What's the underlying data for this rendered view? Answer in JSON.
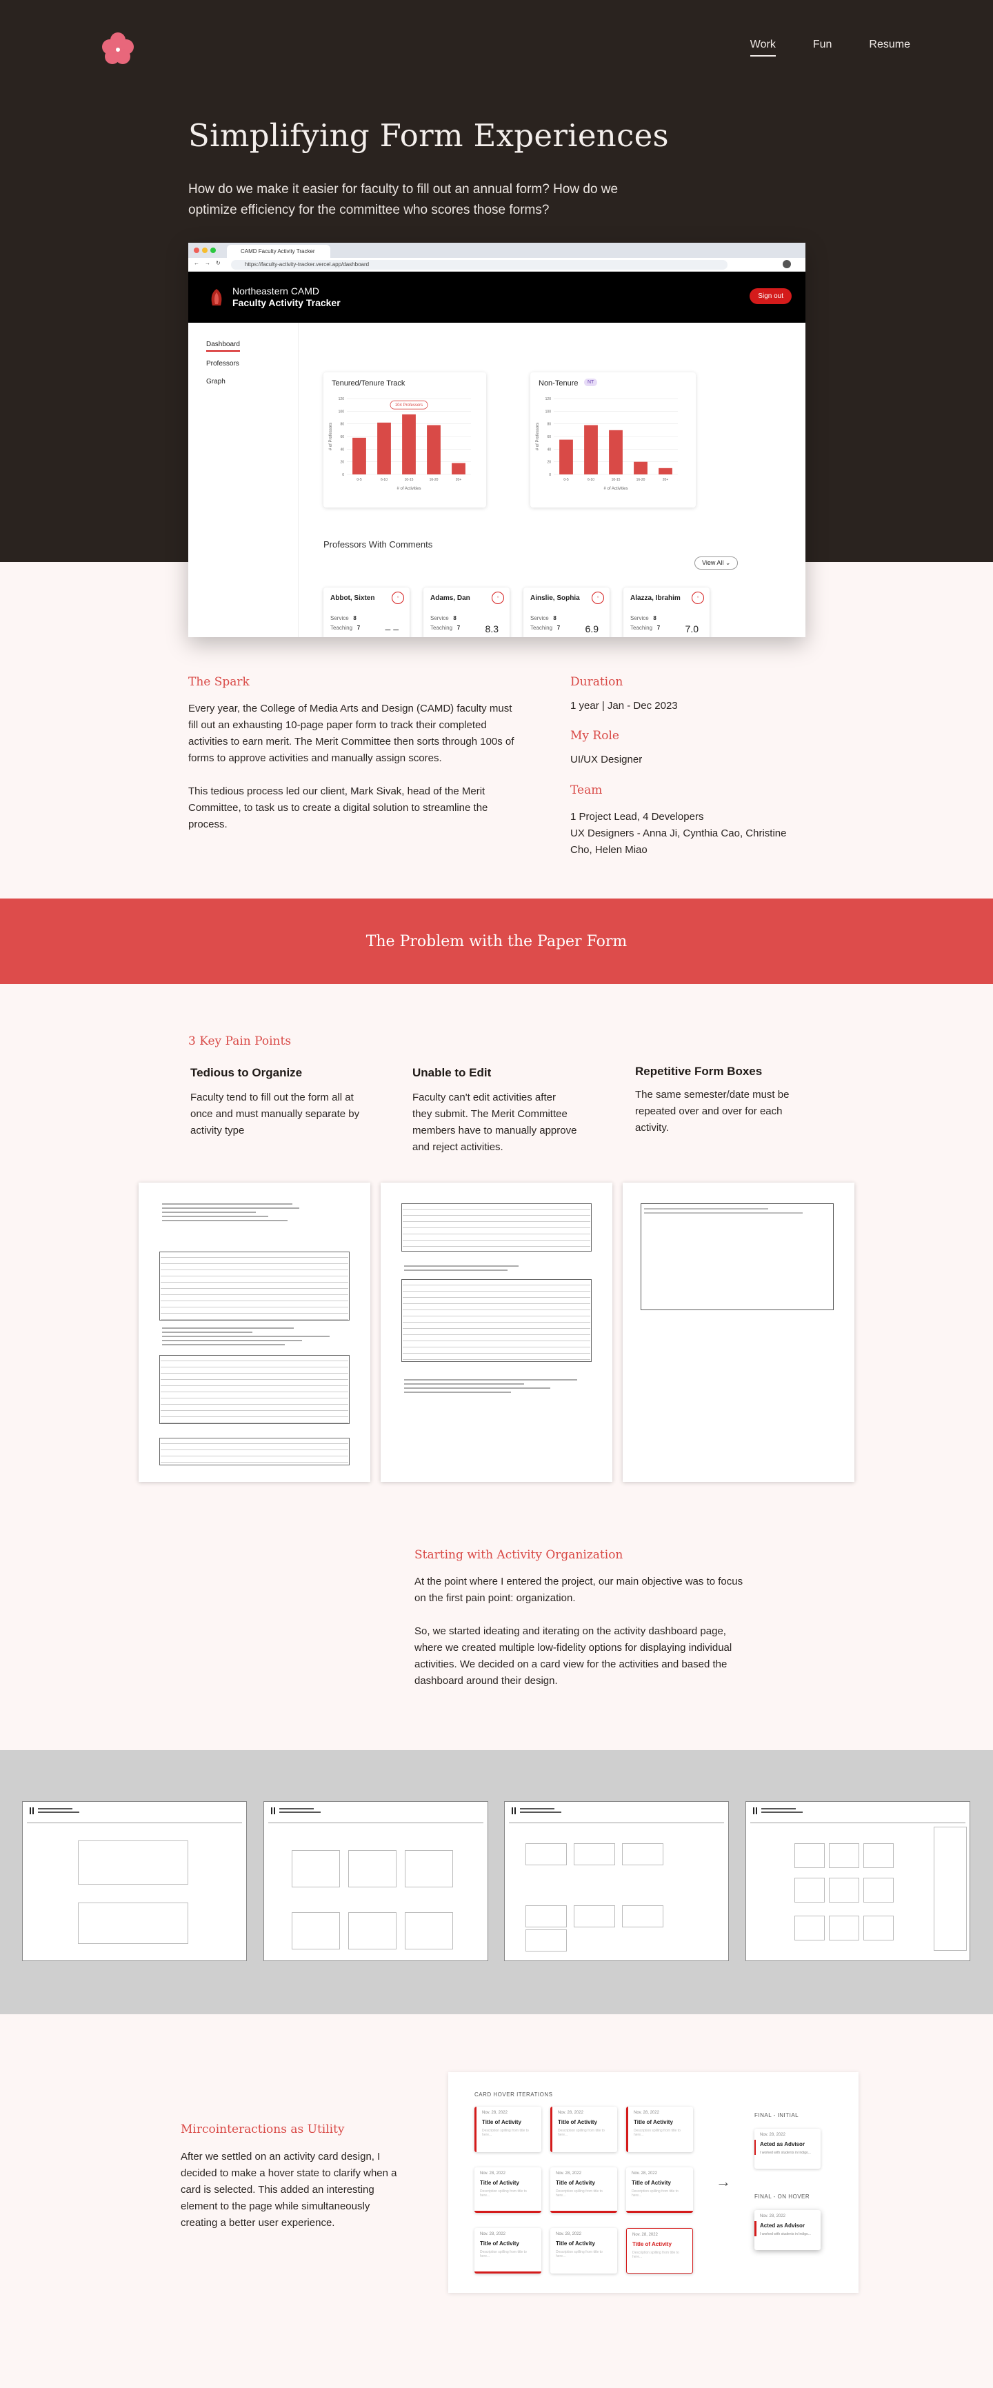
{
  "nav": {
    "work": "Work",
    "fun": "Fun",
    "resume": "Resume"
  },
  "hero": {
    "title": "Simplifying Form Experiences",
    "subtitle": "How do we make it easier for faculty to fill out an annual form? How do we optimize efficiency for the committee who scores those forms?"
  },
  "browser": {
    "tab": "CAMD Faculty Activity Tracker",
    "url": "https://faculty-activity-tracker.vercel.app/dashboard"
  },
  "app": {
    "name1": "Northeastern CAMD",
    "name2": "Faculty Activity Tracker",
    "signout": "Sign out",
    "sidebar": [
      "Dashboard",
      "Professors",
      "Graph"
    ],
    "tenured": {
      "title": "Tenured/Tenure Track",
      "badge": "104 Professors",
      "xlabel": "# of Activities",
      "ylabel": "# of Professors"
    },
    "nontenure": {
      "title": "Non-Tenure",
      "badge": "NT",
      "xlabel": "# of Activities",
      "ylabel": "# of Professors"
    },
    "pwc": "Professors With Comments",
    "viewall": "View All",
    "profs": [
      {
        "name": "Abbot, Sixten",
        "service": "8",
        "teaching": "7",
        "score": "– –"
      },
      {
        "name": "Adams, Dan",
        "service": "8",
        "teaching": "7",
        "score": "8.3"
      },
      {
        "name": "Ainslie, Sophia",
        "service": "8",
        "teaching": "7",
        "score": "6.9"
      },
      {
        "name": "Alazza, Ibrahim",
        "service": "8",
        "teaching": "7",
        "score": "7.0"
      }
    ],
    "service_label": "Service",
    "teaching_label": "Teaching"
  },
  "chart_data": [
    {
      "type": "bar",
      "title": "Tenured/Tenure Track",
      "categories": [
        "0-5",
        "6-10",
        "10-15",
        "16-20",
        "20+"
      ],
      "values": [
        58,
        82,
        95,
        78,
        18
      ],
      "ylim": [
        0,
        120
      ],
      "yticks": [
        0,
        20,
        40,
        60,
        80,
        100,
        120
      ],
      "xlabel": "# of Activities",
      "ylabel": "# of Professors"
    },
    {
      "type": "bar",
      "title": "Non-Tenure",
      "categories": [
        "0-5",
        "6-10",
        "10-15",
        "16-20",
        "20+"
      ],
      "values": [
        55,
        78,
        70,
        20,
        10
      ],
      "ylim": [
        0,
        120
      ],
      "yticks": [
        0,
        20,
        40,
        60,
        80,
        100,
        120
      ],
      "xlabel": "# of Activities",
      "ylabel": "# of Professors"
    }
  ],
  "spark": {
    "title": "The Spark",
    "p1": "Every year, the College of Media Arts and Design (CAMD) faculty must fill out an exhausting 10-page paper form to track their completed activities to earn merit. The Merit Committee then sorts through 100s of forms to approve activities and manually assign scores.",
    "p2": "This tedious process led our client, Mark Sivak, head of the Merit Committee, to task us to create a digital solution to streamline the process."
  },
  "meta": {
    "duration_label": "Duration",
    "duration": "1 year | Jan - Dec 2023",
    "role_label": "My Role",
    "role": "UI/UX Designer",
    "team_label": "Team",
    "team1": "1 Project Lead, 4 Developers",
    "team2": "UX Designers - Anna Ji, Cynthia Cao, Christine Cho, Helen Miao"
  },
  "problem": {
    "title": "The Problem with the Paper Form"
  },
  "pain": {
    "title": "3 Key Pain Points",
    "items": [
      {
        "title": "Tedious to Organize",
        "desc": "Faculty tend to fill out the form all at once and must manually separate by activity type"
      },
      {
        "title": "Unable to Edit",
        "desc": "Faculty can't edit activities after they submit. The Merit Committee members have to manually approve and reject activities."
      },
      {
        "title": "Repetitive Form Boxes",
        "desc": "The same semester/date must be repeated over and over for each activity."
      }
    ]
  },
  "org": {
    "title": "Starting with Activity Organization",
    "p1": "At the point where I entered the project, our main objective was to focus on the first pain point: organization.",
    "p2": "So, we started ideating and iterating on the activity dashboard page, where we created multiple low-fidelity options for displaying individual activities. We decided on a card view for the activities and based the dashboard around their design."
  },
  "micro": {
    "title": "Mircointeractions as Utility",
    "desc": "After we settled on an activity card design, I decided to make a hover state to clarify when a card is selected. This added an interesting element to the page while simultaneously creating a better user experience.",
    "iter_label": "CARD HOVER ITERATIONS",
    "final_initial": "FINAL - INITIAL",
    "final_hover": "FINAL - ON HOVER",
    "card_date": "Nov. 28, 2022",
    "card_title": "Title of Activity",
    "card_desc": "Description spilling from title to here...",
    "final_title": "Acted as Advisor",
    "final_desc": "I worked with students in Indigo..."
  },
  "colors": {
    "accent": "#dd4c4b",
    "dark": "#2a231f",
    "bg": "#fdf6f5"
  }
}
